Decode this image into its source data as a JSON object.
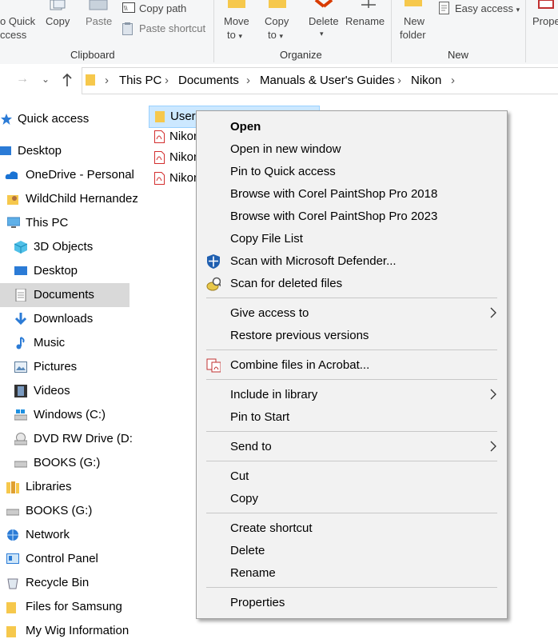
{
  "ribbon": {
    "clipboard": {
      "pin_label_1": "o Quick",
      "pin_label_2": "ccess",
      "copy_label": "Copy",
      "paste_label": "Paste",
      "copy_path_label": "Copy path",
      "paste_shortcut_label": "Paste shortcut",
      "group_label": "Clipboard"
    },
    "organize": {
      "move_label_1": "Move",
      "move_label_2": "to",
      "copy_label_1": "Copy",
      "copy_label_2": "to",
      "delete_label": "Delete",
      "rename_label": "Rename",
      "group_label": "Organize"
    },
    "new": {
      "new_folder_1": "New",
      "new_folder_2": "folder",
      "easy_access_label": "Easy access",
      "group_label": "New"
    },
    "open": {
      "properties_label": "Prope"
    }
  },
  "address": {
    "crumbs": [
      "This PC",
      "Documents",
      "Manuals & User's Guides",
      "Nikon"
    ]
  },
  "nav_pane": {
    "items": [
      {
        "label": "Quick access",
        "icon": "star-icon"
      },
      {
        "label": "Desktop",
        "icon": "desktop-icon"
      },
      {
        "label": "OneDrive - Personal",
        "icon": "cloud-icon"
      },
      {
        "label": "WildChild Hernandez",
        "icon": "user-folder-icon"
      },
      {
        "label": "This PC",
        "icon": "computer-icon"
      },
      {
        "label": "3D Objects",
        "icon": "cube-icon"
      },
      {
        "label": "Desktop",
        "icon": "desktop-icon"
      },
      {
        "label": "Documents",
        "icon": "document-icon"
      },
      {
        "label": "Downloads",
        "icon": "download-icon"
      },
      {
        "label": "Music",
        "icon": "music-icon"
      },
      {
        "label": "Pictures",
        "icon": "pictures-icon"
      },
      {
        "label": "Videos",
        "icon": "video-icon"
      },
      {
        "label": "Windows (C:)",
        "icon": "drive-icon"
      },
      {
        "label": "DVD RW Drive (D:",
        "icon": "dvd-icon"
      },
      {
        "label": "BOOKS (G:)",
        "icon": "drive-icon"
      },
      {
        "label": "Libraries",
        "icon": "library-icon"
      },
      {
        "label": "BOOKS (G:)",
        "icon": "drive-icon"
      },
      {
        "label": "Network",
        "icon": "network-icon"
      },
      {
        "label": "Control Panel",
        "icon": "control-panel-icon"
      },
      {
        "label": "Recycle Bin",
        "icon": "recycle-bin-icon"
      },
      {
        "label": "Files for Samsung",
        "icon": "folder-icon"
      },
      {
        "label": "My Wig Information",
        "icon": "folder-icon"
      }
    ]
  },
  "files": [
    {
      "name": "User",
      "icon": "folder-icon",
      "selected": true
    },
    {
      "name": "Nikon",
      "icon": "pdf-icon"
    },
    {
      "name": "Nikon",
      "icon": "pdf-icon"
    },
    {
      "name": "Nikon",
      "icon": "pdf-icon"
    }
  ],
  "context_menu": {
    "items": [
      "Open",
      "Open in new window",
      "Pin to Quick access",
      "Browse with Corel PaintShop Pro 2018",
      "Browse with Corel PaintShop Pro 2023",
      "Copy File List",
      "Scan with Microsoft Defender...",
      "Scan for deleted files",
      "Give access to",
      "Restore previous versions",
      "Combine files in Acrobat...",
      "Include in library",
      "Pin to Start",
      "Send to",
      "Cut",
      "Copy",
      "Create shortcut",
      "Delete",
      "Rename",
      "Properties"
    ]
  },
  "colors": {
    "selection": "#cce8ff",
    "nav_selected": "#d9d9d9",
    "menu_bg": "#f2f2f2",
    "folder": "#f6c84c",
    "pdf_red": "#d32f2f",
    "delete_red": "#d83b01"
  }
}
